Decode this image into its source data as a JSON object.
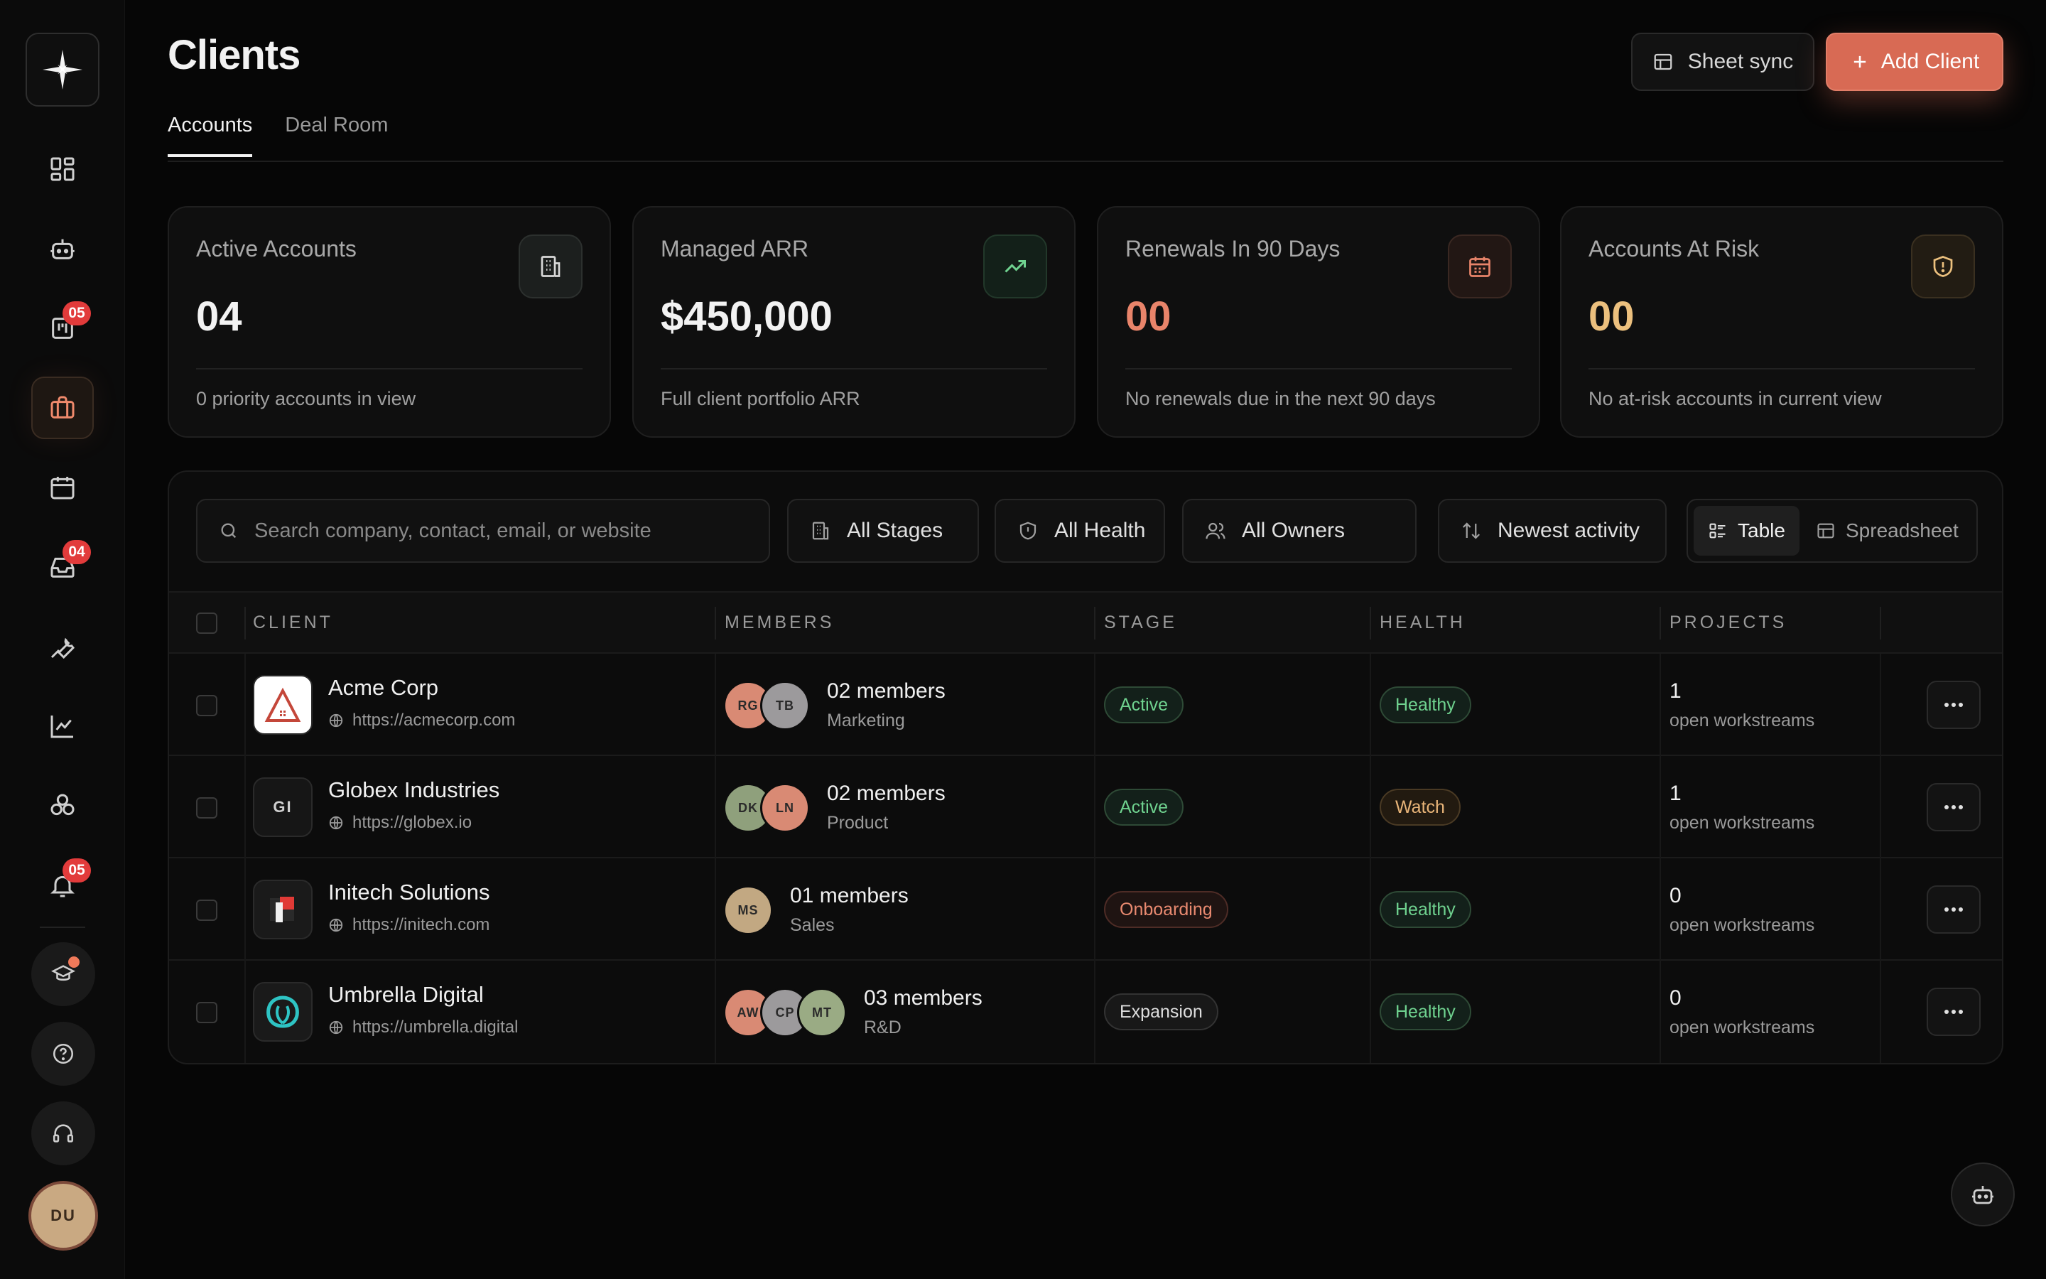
{
  "header": {
    "title": "Clients",
    "sync_label": "Sheet sync",
    "add_label": "Add Client"
  },
  "tabs": [
    {
      "label": "Accounts",
      "active": true
    },
    {
      "label": "Deal Room",
      "active": false
    }
  ],
  "sidebar": {
    "badges": {
      "projects": "05",
      "inbox": "04",
      "notifications": "05"
    },
    "user_initials": "DU"
  },
  "stats": [
    {
      "label": "Active Accounts",
      "value": "04",
      "sub": "0 priority accounts in view",
      "icon": "building-icon",
      "value_color": "#f2f2f2"
    },
    {
      "label": "Managed ARR",
      "value": "$450,000",
      "sub": "Full client portfolio ARR",
      "icon": "trending-up-icon",
      "value_color": "#f2f2f2"
    },
    {
      "label": "Renewals In 90 Days",
      "value": "00",
      "sub": "No renewals due in the next 90 days",
      "icon": "calendar-icon",
      "value_color": "#e8846a"
    },
    {
      "label": "Accounts At Risk",
      "value": "00",
      "sub": "No at-risk accounts in current view",
      "icon": "shield-alert-icon",
      "value_color": "#ecc07e"
    }
  ],
  "filters": {
    "search_placeholder": "Search company, contact, email, or website",
    "stage": "All Stages",
    "health": "All Health",
    "owner": "All Owners",
    "sort": "Newest activity",
    "view_table": "Table",
    "view_spreadsheet": "Spreadsheet"
  },
  "table": {
    "columns": [
      "CLIENT",
      "MEMBERS",
      "STAGE",
      "HEALTH",
      "PROJECTS"
    ],
    "rows": [
      {
        "name": "Acme Corp",
        "url": "https://acmecorp.com",
        "logo": "acme-logo",
        "initials": "",
        "members": [
          {
            "initials": "RG",
            "color": "#d98a74"
          },
          {
            "initials": "TB",
            "color": "#9c9a9c"
          }
        ],
        "members_count": "02 members",
        "team": "Marketing",
        "stage": "Active",
        "stage_class": "stage-active",
        "health": "Healthy",
        "health_class": "health-healthy",
        "projects": "1",
        "projects_label": "open workstreams"
      },
      {
        "name": "Globex Industries",
        "url": "https://globex.io",
        "logo": "initials",
        "initials": "GI",
        "members": [
          {
            "initials": "DK",
            "color": "#8fa07c"
          },
          {
            "initials": "LN",
            "color": "#d98a74"
          }
        ],
        "members_count": "02 members",
        "team": "Product",
        "stage": "Active",
        "stage_class": "stage-active",
        "health": "Watch",
        "health_class": "health-watch",
        "projects": "1",
        "projects_label": "open workstreams"
      },
      {
        "name": "Initech Solutions",
        "url": "https://initech.com",
        "logo": "initech-logo",
        "initials": "",
        "members": [
          {
            "initials": "MS",
            "color": "#c2a882"
          }
        ],
        "members_count": "01 members",
        "team": "Sales",
        "stage": "Onboarding",
        "stage_class": "stage-onboarding",
        "health": "Healthy",
        "health_class": "health-healthy",
        "projects": "0",
        "projects_label": "open workstreams"
      },
      {
        "name": "Umbrella Digital",
        "url": "https://umbrella.digital",
        "logo": "umbrella-logo",
        "initials": "",
        "members": [
          {
            "initials": "AW",
            "color": "#d98a74"
          },
          {
            "initials": "CP",
            "color": "#9c9a9c"
          },
          {
            "initials": "MT",
            "color": "#9aab84"
          }
        ],
        "members_count": "03 members",
        "team": "R&D",
        "stage": "Expansion",
        "stage_class": "stage-expansion",
        "health": "Healthy",
        "health_class": "health-healthy",
        "projects": "0",
        "projects_label": "open workstreams"
      }
    ]
  }
}
